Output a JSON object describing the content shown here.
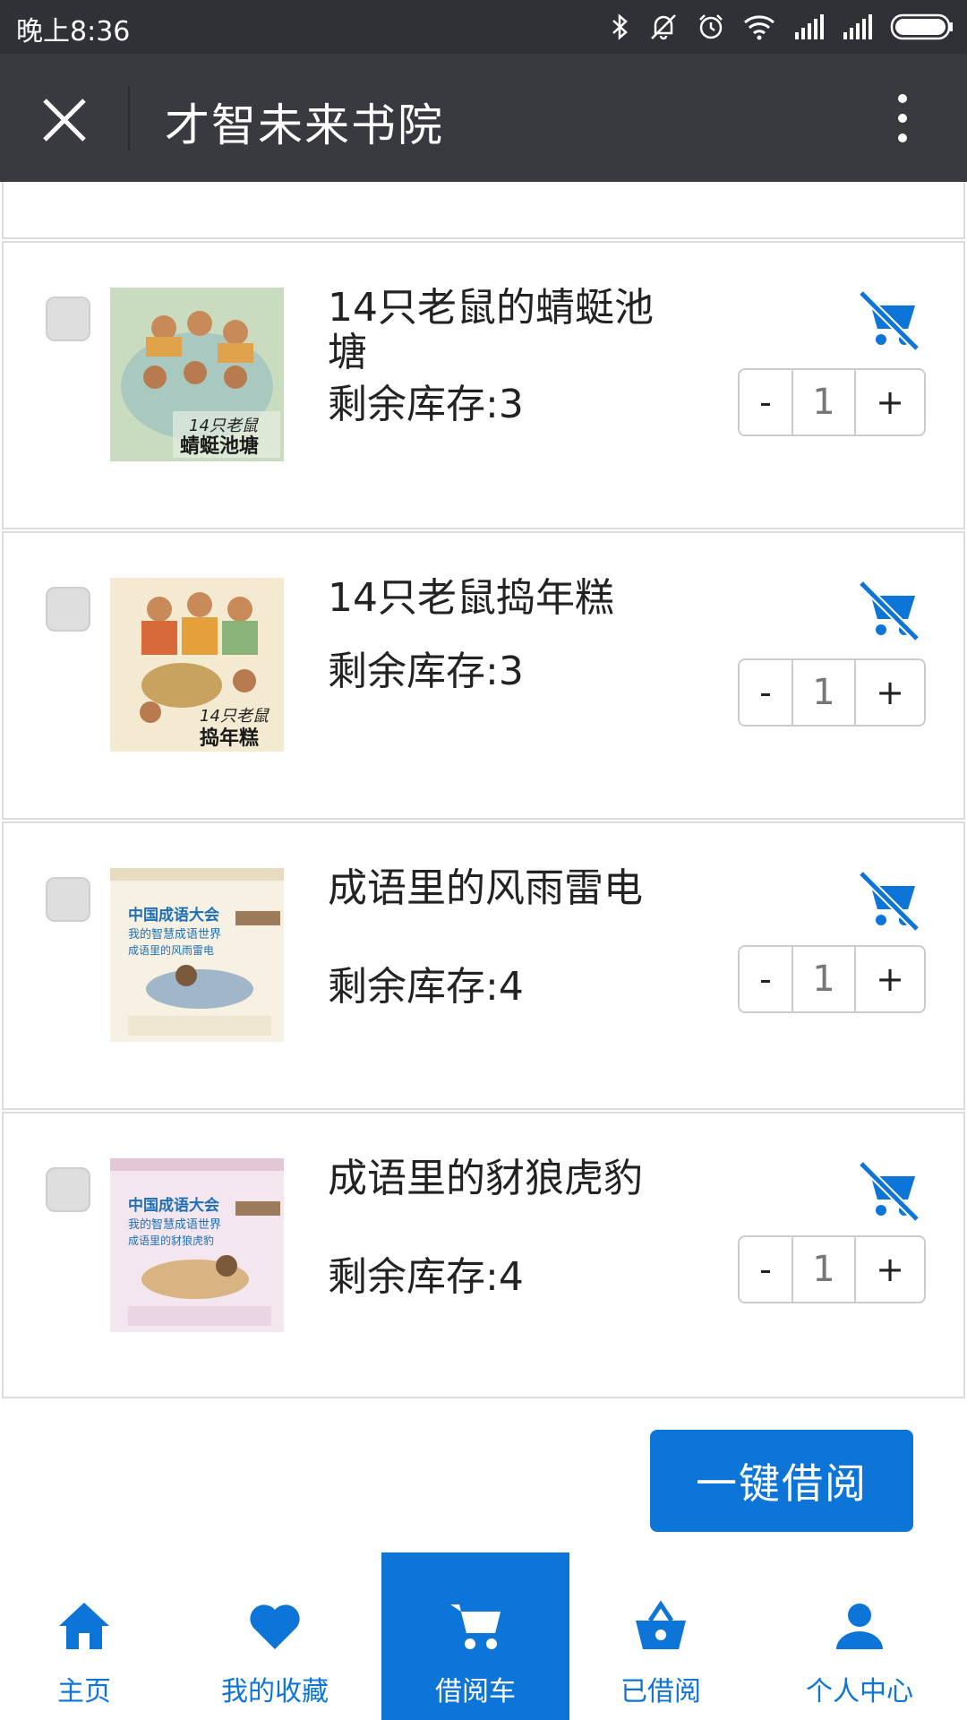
{
  "status_bar": {
    "time": "晚上8:36"
  },
  "header": {
    "title": "才智未来书院"
  },
  "colors": {
    "accent": "#0d75d8",
    "header_bg": "#393a3f",
    "status_bg": "#2f3136"
  },
  "cart_items": [
    {
      "name": "14只老鼠的蜻蜓池塘",
      "stock_label": "剩余库存:3",
      "qty": "1",
      "minus": "-",
      "plus": "+",
      "cover_text": "14只老鼠 蜻蜓池塘"
    },
    {
      "name": "14只老鼠捣年糕",
      "stock_label": "剩余库存:3",
      "qty": "1",
      "minus": "-",
      "plus": "+",
      "cover_text": "14只老鼠 捣年糕"
    },
    {
      "name": "成语里的风雨雷电",
      "stock_label": "剩余库存:4",
      "qty": "1",
      "minus": "-",
      "plus": "+",
      "cover_text": "中国成语大会 我的智慧成语世界 成语里的风雨雷电"
    },
    {
      "name": "成语里的豺狼虎豹",
      "stock_label": "剩余库存:4",
      "qty": "1",
      "minus": "-",
      "plus": "+",
      "cover_text": "中国成语大会 我的智慧成语世界 成语里的豺狼虎豹"
    }
  ],
  "actions": {
    "borrow_all": "一键借阅"
  },
  "tabs": [
    {
      "label": "主页",
      "icon": "home-icon"
    },
    {
      "label": "我的收藏",
      "icon": "heart-icon"
    },
    {
      "label": "借阅车",
      "icon": "cart-icon",
      "active": true
    },
    {
      "label": "已借阅",
      "icon": "basket-icon"
    },
    {
      "label": "个人中心",
      "icon": "person-icon"
    }
  ]
}
